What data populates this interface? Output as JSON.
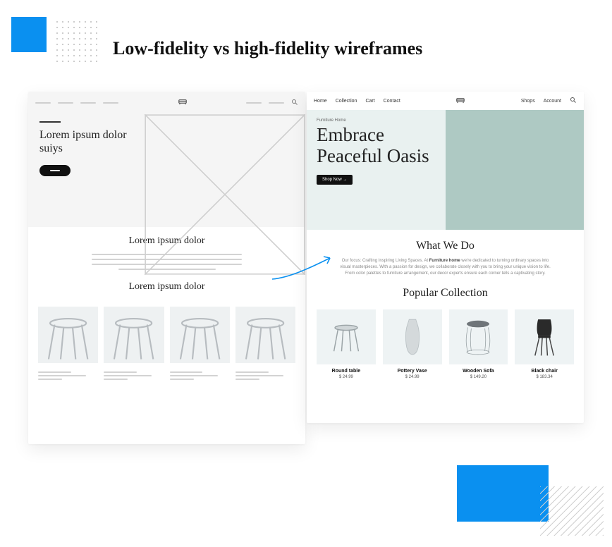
{
  "title": "Low-fidelity vs high-fidelity wireframes",
  "lofi": {
    "hero_heading": "Lorem ipsum dolor suiys",
    "section1_heading": "Lorem ipsum dolor",
    "section2_heading": "Lorem ipsum dolor"
  },
  "hifi": {
    "nav": {
      "left": [
        "Home",
        "Collection",
        "Cart",
        "Contact"
      ],
      "right": [
        "Shops",
        "Account"
      ]
    },
    "hero_kicker": "Furniture Home",
    "hero_heading": "Embrace Peaceful Oasis",
    "hero_button": "Shop Now →",
    "section1_heading": "What We Do",
    "section1_body_prefix": "Our focus: Crafting Inspiring Living Spaces. At ",
    "section1_body_brand": "Furniture home",
    "section1_body_suffix": " we're dedicated to turning ordinary spaces into visual masterpieces. With a passion for design, we collaborate closely with you to bring your unique vision to life. From color palettes to furniture arrangement, our decor experts ensure each corner tells a captivating story.",
    "section2_heading": "Popular Collection",
    "products": [
      {
        "name": "Round table",
        "price": "$ 24.99"
      },
      {
        "name": "Pottery Vase",
        "price": "$ 24.99"
      },
      {
        "name": "Wooden Sofa",
        "price": "$ 149.20"
      },
      {
        "name": "Black chair",
        "price": "$ 183.34"
      }
    ]
  }
}
